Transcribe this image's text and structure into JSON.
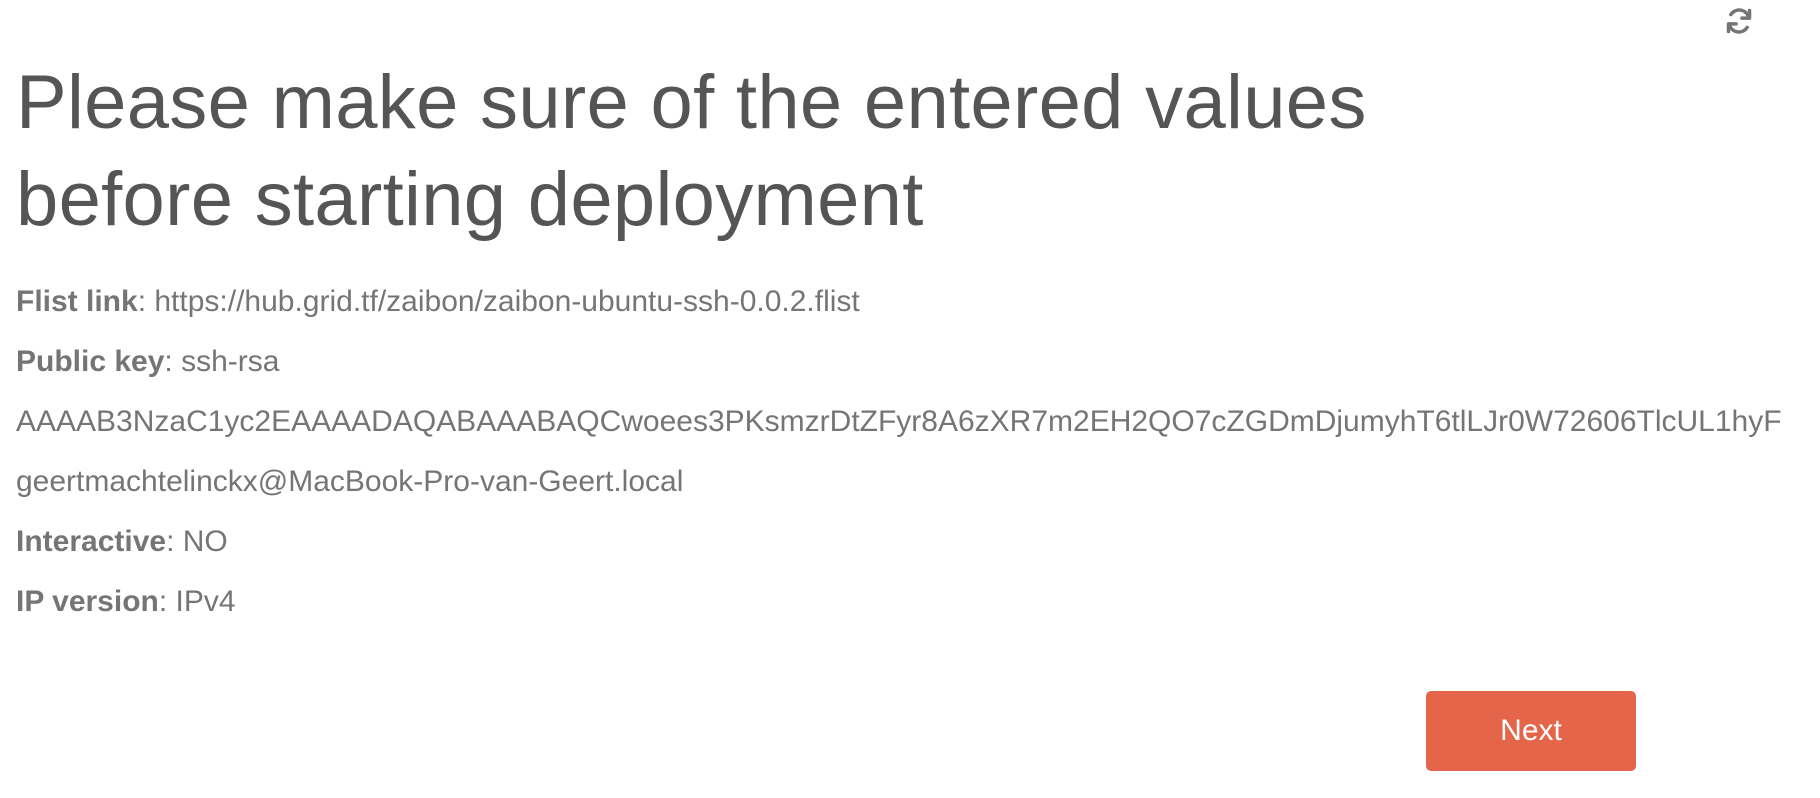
{
  "toolbar": {
    "refresh_icon": "refresh-icon"
  },
  "page": {
    "title": "Please make sure of the entered values before starting deployment"
  },
  "details": {
    "flist": {
      "label": "Flist link",
      "value": "https://hub.grid.tf/zaibon/zaibon-ubuntu-ssh-0.0.2.flist"
    },
    "public_key": {
      "label": "Public key",
      "value_line1": "ssh-rsa",
      "value_line2": "AAAAB3NzaC1yc2EAAAADAQABAAABAQCwoees3PKsmzrDtZFyr8A6zXR7m2EH2QO7cZGDmDjumyhT6tlLJr0W72606TlcUL1hyF",
      "value_line3": "geertmachtelinckx@MacBook-Pro-van-Geert.local"
    },
    "interactive": {
      "label": "Interactive",
      "value": "NO"
    },
    "ip_version": {
      "label": "IP version",
      "value": "IPv4"
    }
  },
  "actions": {
    "next_label": "Next"
  },
  "colors": {
    "accent": "#e5654a",
    "title_text": "#555555",
    "body_text": "#757575"
  }
}
